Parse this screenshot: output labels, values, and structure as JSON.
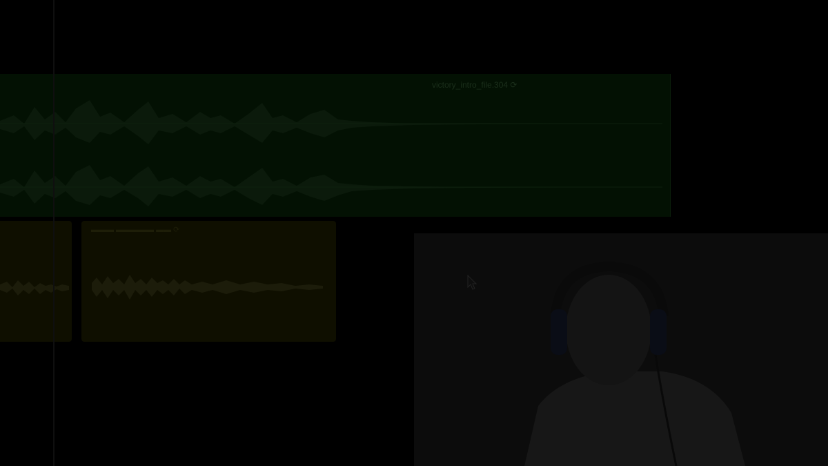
{
  "timeline": {
    "music_clip": {
      "title": "victory_intro_file.304 ⟳",
      "color": "#031103"
    },
    "voice_clip_a": {
      "title": "",
      "color": "#0f0f00"
    },
    "voice_clip_b": {
      "title": "▬▬▬ ▬▬▬▬▬ ▬▬ ⟳",
      "color": "#0f0f00"
    }
  },
  "webcam": {
    "description_icon": "person-headphones"
  },
  "cursor": {
    "icon": "arrow-cursor"
  }
}
